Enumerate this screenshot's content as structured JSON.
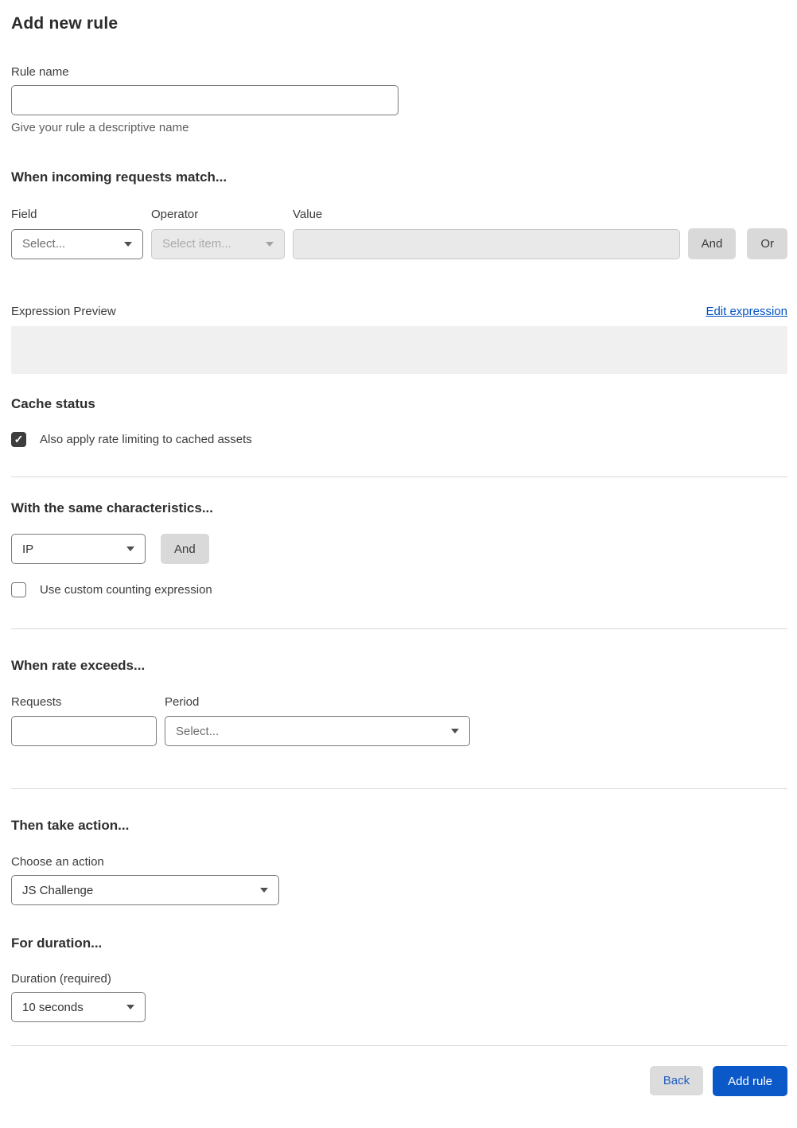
{
  "page": {
    "title": "Add new rule"
  },
  "rule_name": {
    "label": "Rule name",
    "value": "",
    "helper": "Give your rule a descriptive name"
  },
  "match": {
    "heading": "When incoming requests match...",
    "field": {
      "label": "Field",
      "placeholder": "Select..."
    },
    "operator": {
      "label": "Operator",
      "placeholder": "Select item...",
      "disabled": true
    },
    "value": {
      "label": "Value",
      "value": "",
      "disabled": true
    },
    "and_label": "And",
    "or_label": "Or"
  },
  "expression": {
    "label": "Expression Preview",
    "edit_link": "Edit expression",
    "preview": ""
  },
  "cache": {
    "heading": "Cache status",
    "checkbox_label": "Also apply rate limiting to cached assets",
    "checked": true
  },
  "characteristics": {
    "heading": "With the same characteristics...",
    "selected": "IP",
    "and_label": "And",
    "checkbox_label": "Use custom counting expression",
    "checked": false
  },
  "rate": {
    "heading": "When rate exceeds...",
    "requests": {
      "label": "Requests",
      "value": ""
    },
    "period": {
      "label": "Period",
      "placeholder": "Select..."
    }
  },
  "action": {
    "heading": "Then take action...",
    "label": "Choose an action",
    "selected": "JS Challenge"
  },
  "duration": {
    "heading": "For duration...",
    "label": "Duration (required)",
    "selected": "10 seconds"
  },
  "footer": {
    "back_label": "Back",
    "add_label": "Add rule"
  },
  "colors": {
    "link_blue": "#0051c3",
    "primary_button_blue": "#0b58c9",
    "checkbox_checked": "#3d3d3d",
    "disabled_fill": "#e9e9e9",
    "preview_fill": "#f0f0f0",
    "divider": "#d8d8d8"
  }
}
